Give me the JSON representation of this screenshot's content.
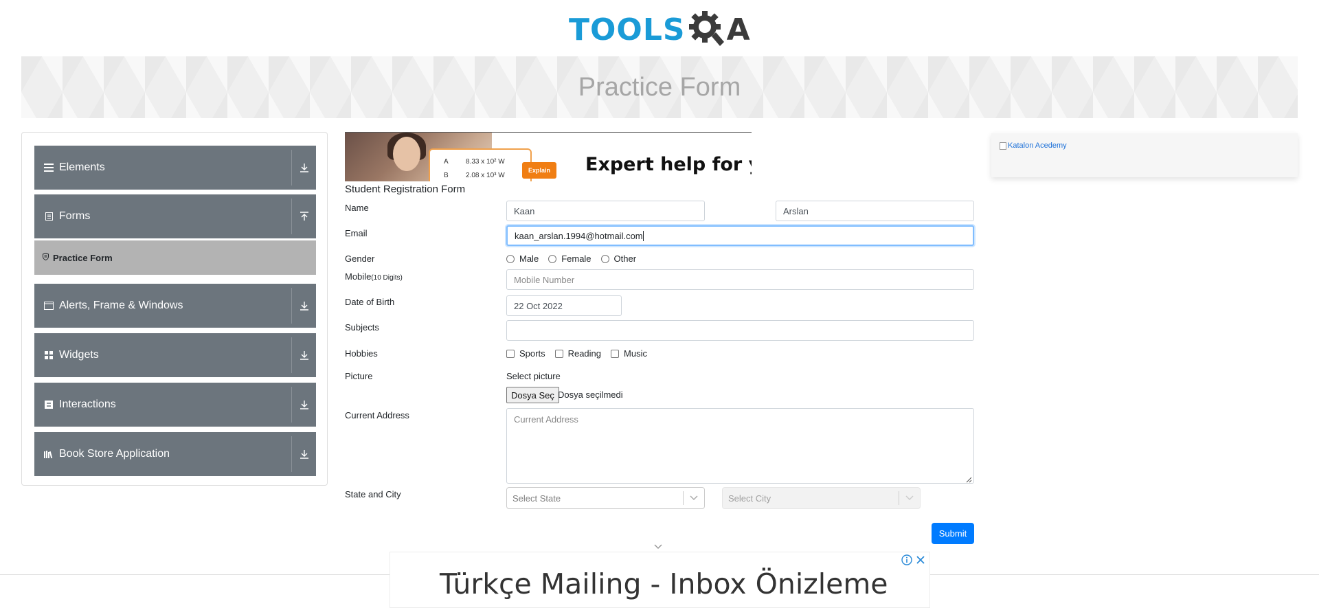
{
  "header": {
    "logo_text_left": "TOOLS",
    "logo_text_right": "A",
    "page_title": "Practice Form"
  },
  "sidebar": {
    "groups": [
      {
        "label": "Elements",
        "icon": "hamburger-icon",
        "state": "collapsed"
      },
      {
        "label": "Forms",
        "icon": "document-icon",
        "state": "expanded"
      },
      {
        "label": "Alerts, Frame & Windows",
        "icon": "window-icon",
        "state": "collapsed"
      },
      {
        "label": "Widgets",
        "icon": "grid-icon",
        "state": "collapsed"
      },
      {
        "label": "Interactions",
        "icon": "interaction-icon",
        "state": "collapsed"
      },
      {
        "label": "Book Store Application",
        "icon": "books-icon",
        "state": "collapsed"
      }
    ],
    "active_item": "Practice Form"
  },
  "ad_top": {
    "headline": "Expert help for you",
    "row1_letter": "A",
    "row1_value": "8.33 x 10² W",
    "row2_letter": "B",
    "row2_value": "2.08 x 10³ W",
    "button": "Explain"
  },
  "form": {
    "title": "Student Registration Form",
    "labels": {
      "name": "Name",
      "email": "Email",
      "gender": "Gender",
      "mobile": "Mobile",
      "mobile_hint": "(10 Digits)",
      "dob": "Date of Birth",
      "subjects": "Subjects",
      "hobbies": "Hobbies",
      "picture": "Picture",
      "address": "Current Address",
      "state_city": "State and City"
    },
    "first_name": "Kaan",
    "last_name": "Arslan",
    "email": "kaan_arslan.1994@hotmail.com",
    "genders": [
      "Male",
      "Female",
      "Other"
    ],
    "mobile_placeholder": "Mobile Number",
    "dob": "22 Oct 2022",
    "subjects": "",
    "hobbies": [
      "Sports",
      "Reading",
      "Music"
    ],
    "picture_label": "Select picture",
    "file_button": "Dosya Seç",
    "file_status": "Dosya seçilmedi",
    "address_placeholder": "Current Address",
    "state_placeholder": "Select State",
    "city_placeholder": "Select City",
    "submit": "Submit"
  },
  "right_ad": {
    "alt_text": "Katalon Acedemy"
  },
  "bottom_ad": {
    "text": "Türkçe Mailing - Inbox Önizleme"
  },
  "colors": {
    "accent": "#007bff",
    "sidebar_group": "#6c757d",
    "sidebar_active": "#b3b3b3",
    "logo_blue": "#1a9bd7",
    "ad_orange": "#f07e13"
  }
}
